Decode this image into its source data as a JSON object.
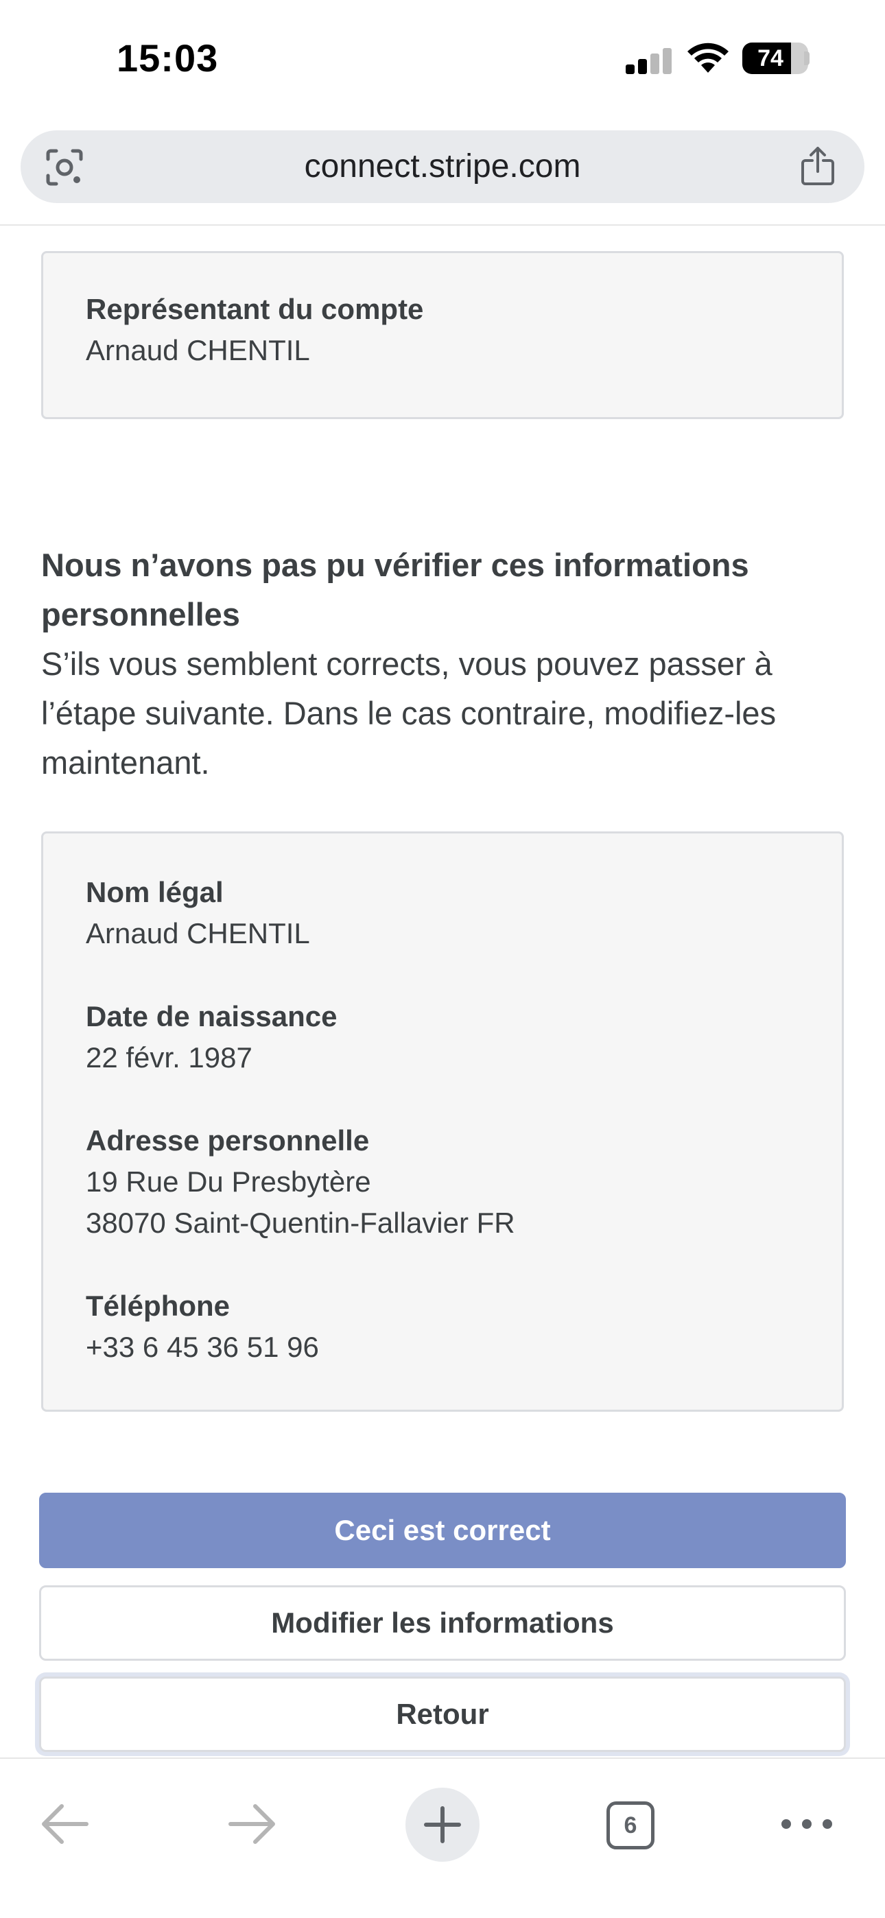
{
  "status_bar": {
    "time": "15:03",
    "battery_percent": "74",
    "battery_level": 0.74,
    "signal_bars": 2,
    "icons": [
      "signal-icon",
      "wifi-icon",
      "battery-icon"
    ]
  },
  "browser": {
    "url": "connect.stripe.com",
    "icons": [
      "lens-icon",
      "share-icon"
    ]
  },
  "account_card": {
    "label": "Représentant du compte",
    "value": "Arnaud CHENTIL"
  },
  "verification": {
    "heading_line1": "Nous n’avons pas pu vérifier ces informations",
    "heading_line2": "personnelles",
    "text_line1": "S’ils vous semblent corrects, vous pouvez passer à",
    "text_line2": "l’étape suivante. Dans le cas contraire, modifiez-les",
    "text_line3": "maintenant."
  },
  "personal_info": {
    "legal_name_label": "Nom légal",
    "legal_name": "Arnaud CHENTIL",
    "birth_date_label": "Date de naissance",
    "birth_date": "22 févr. 1987",
    "address_label": "Adresse personnelle",
    "address_line1": "19 Rue Du Presbytère",
    "address_line2": "38070 Saint-Quentin-Fallavier FR",
    "phone_label": "Téléphone",
    "phone": "+33 6 45 36 51 96"
  },
  "actions": {
    "confirm_label": "Ceci est correct",
    "edit_label": "Modifier les informations",
    "back_label": "Retour",
    "confirm_color": "#7a8ec6"
  },
  "toolbar": {
    "tab_count": "6",
    "icons": [
      "back-arrow-icon",
      "forward-arrow-icon",
      "plus-icon",
      "tabs-icon",
      "more-icon"
    ]
  }
}
